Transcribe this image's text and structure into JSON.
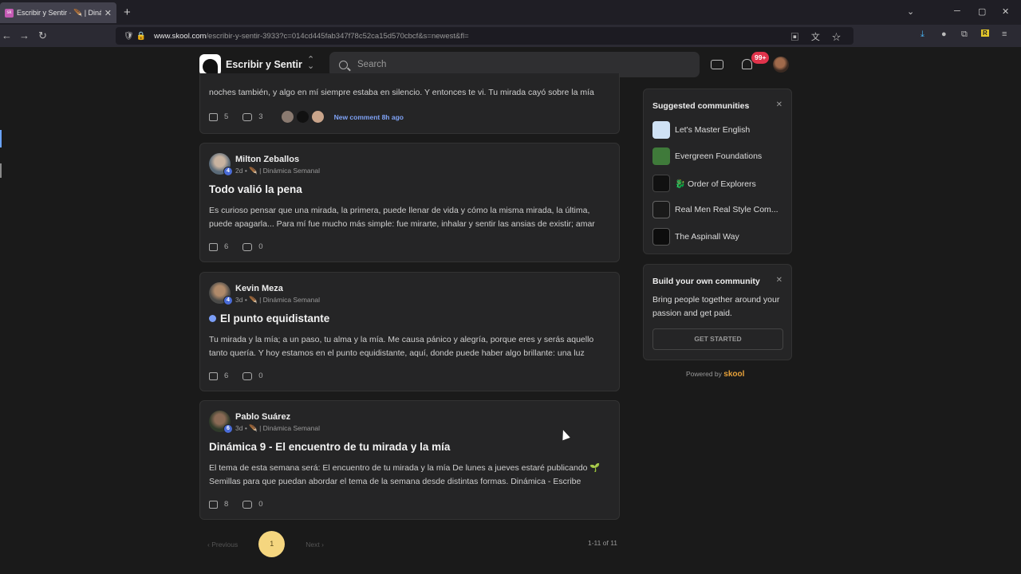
{
  "browser": {
    "tab_title": "Escribir y Sentir · 🪶 | Dinámica",
    "tab_favicon": "sk",
    "url_host": "www.skool.com",
    "url_path": "/escribir-y-sentir-3933?c=014cd445fab347f78c52ca15d570cbcf&s=newest&fl="
  },
  "header": {
    "community_name": "Escribir y Sentir",
    "search_placeholder": "Search",
    "notification_badge": "99+"
  },
  "feed": {
    "posts": [
      {
        "author": "",
        "title": "",
        "body_line2": "noches también, y algo en mí siempre estaba en silencio. Y entonces te vi. Tu mirada cayó sobre la mía",
        "likes": "5",
        "comments": "3",
        "new_comment": "New comment 8h ago"
      },
      {
        "author": "Milton Zeballos",
        "level": "4",
        "meta": "2d • 🪶 | Dinámica Semanal",
        "title": "Todo valió la pena",
        "body": "Es curioso pensar que una mirada, la primera, puede llenar de vida y cómo la misma mirada, la última, puede apagarla... Para mí fue mucho más simple: fue mirarte, inhalar y sentir las ansias de existir; amar",
        "likes": "6",
        "comments": "0"
      },
      {
        "author": "Kevin Meza",
        "level": "4",
        "meta": "3d • 🪶 | Dinámica Semanal",
        "title": "El punto equidistante",
        "body": "Tu mirada y la mía; a un paso, tu alma y la mía. Me causa pánico y alegría, porque eres y serás aquello tanto quería. Y hoy estamos en el punto equidistante, aquí, donde puede haber algo brillante: una luz",
        "likes": "6",
        "comments": "0"
      },
      {
        "author": "Pablo Suárez",
        "level": "6",
        "meta": "3d • 🪶 | Dinámica Semanal",
        "title": "Dinámica 9 - El encuentro de tu mirada y la mía",
        "body": "El tema de esta semana será: El encuentro de tu mirada y la mía De lunes a jueves estaré publicando 🌱 Semillas para que puedan abordar el tema de la semana desde distintas formas. Dinámica - Escribe",
        "likes": "8",
        "comments": "0"
      }
    ]
  },
  "pagination": {
    "previous": "‹ Previous",
    "current": "1",
    "next": "Next ›",
    "range": "1-11 of 11"
  },
  "sidebar": {
    "suggested_title": "Suggested communities",
    "communities": [
      {
        "name": "Let's Master English",
        "color": "#cfe2f5"
      },
      {
        "name": "Evergreen Foundations",
        "color": "#3f7a3a"
      },
      {
        "name": "🐉 Order of Explorers",
        "color": "#111111"
      },
      {
        "name": "Real Men Real Style Com...",
        "color": "#1a1a1a"
      },
      {
        "name": "The Aspinall Way",
        "color": "#0d0d0d"
      }
    ],
    "build_title": "Build your own community",
    "build_text": "Bring people together around your passion and get paid.",
    "get_started": "GET STARTED",
    "powered_by": "Powered by",
    "brand": "skool"
  }
}
